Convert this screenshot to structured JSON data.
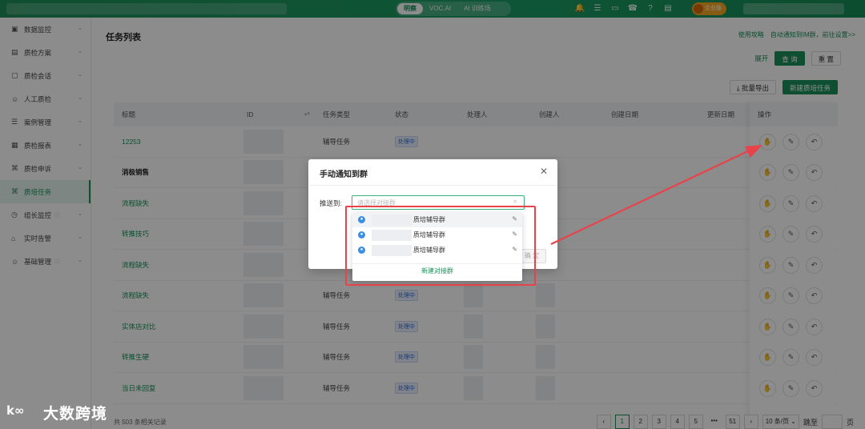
{
  "topbar": {
    "modes": [
      {
        "label": "明察",
        "active": true
      },
      {
        "label": "VOC.AI",
        "active": false
      },
      {
        "label": "AI 训练场",
        "active": false
      }
    ],
    "icons": [
      "bell-icon",
      "sliders-icon",
      "link-icon",
      "headset-icon",
      "help-icon",
      "doc-icon"
    ],
    "enterprise_label": "企业版"
  },
  "sidebar": {
    "items": [
      {
        "label": "数据监控",
        "icon": "monitor-icon",
        "chevron": true,
        "active": false,
        "info": false
      },
      {
        "label": "质检方案",
        "icon": "plan-icon",
        "chevron": true,
        "active": false,
        "info": false
      },
      {
        "label": "质检会话",
        "icon": "chat-icon",
        "chevron": true,
        "active": false,
        "info": false
      },
      {
        "label": "人工质检",
        "icon": "person-icon",
        "chevron": true,
        "active": false,
        "info": false
      },
      {
        "label": "案例管理",
        "icon": "layers-icon",
        "chevron": true,
        "active": false,
        "info": false
      },
      {
        "label": "质检报表",
        "icon": "report-icon",
        "chevron": true,
        "active": false,
        "info": false
      },
      {
        "label": "质检申诉",
        "icon": "appeal-icon",
        "chevron": true,
        "active": false,
        "info": false
      },
      {
        "label": "质培任务",
        "icon": "task-icon",
        "chevron": false,
        "active": true,
        "info": false
      },
      {
        "label": "组长监控",
        "icon": "clock-icon",
        "chevron": true,
        "active": false,
        "info": true
      },
      {
        "label": "实时告警",
        "icon": "alarm-icon",
        "chevron": true,
        "active": false,
        "info": false
      },
      {
        "label": "基础管理",
        "icon": "user-admin-icon",
        "chevron": true,
        "active": false,
        "info": true
      }
    ]
  },
  "main": {
    "title": "任务列表",
    "help_links": [
      "使用攻略",
      "自动通知到IM群，前往设置>>"
    ],
    "expand_label": "展开",
    "query_label": "查 询",
    "reset_label": "重 置",
    "export_label": "批量导出",
    "new_task_label": "新建质培任务"
  },
  "table": {
    "columns": [
      {
        "label": "标题",
        "w": 156
      },
      {
        "label": "ID",
        "w": 95,
        "sort": true
      },
      {
        "label": "任务类型",
        "w": 90
      },
      {
        "label": "状态",
        "w": 90
      },
      {
        "label": "处理人",
        "w": 90
      },
      {
        "label": "创建人",
        "w": 90
      },
      {
        "label": "创建日期",
        "w": 120
      },
      {
        "label": "更新日期",
        "w": 72
      }
    ],
    "ops_header": "操作",
    "rows": [
      {
        "title": "12253",
        "bold": false,
        "type": "辅导任务",
        "status": "处理中"
      },
      {
        "title": "消极销售",
        "bold": true,
        "type": "",
        "status": ""
      },
      {
        "title": "流程缺失",
        "bold": false,
        "type": "",
        "status": ""
      },
      {
        "title": "转推技巧",
        "bold": false,
        "type": "",
        "status": ""
      },
      {
        "title": "流程缺失",
        "bold": false,
        "type": "",
        "status": ""
      },
      {
        "title": "流程缺失",
        "bold": false,
        "type": "辅导任务",
        "status": "处理中"
      },
      {
        "title": "实体店对比",
        "bold": false,
        "type": "辅导任务",
        "status": "处理中"
      },
      {
        "title": "转推生硬",
        "bold": false,
        "type": "辅导任务",
        "status": "处理中"
      },
      {
        "title": "当日未回复",
        "bold": false,
        "type": "辅导任务",
        "status": "处理中"
      }
    ]
  },
  "pagination": {
    "total_text": "共 503 条相关记录",
    "pages": [
      "1",
      "2",
      "3",
      "4",
      "5",
      "•••",
      "51"
    ],
    "active_page": "1",
    "page_size": "10 条/页",
    "jump_label": "跳至",
    "page_unit": "页"
  },
  "modal": {
    "title": "手动通知到群",
    "push_label": "推送到:",
    "placeholder": "请选择对接群",
    "confirm_label": "确 定",
    "options": [
      {
        "label": "质培辅导群"
      },
      {
        "label": "质培辅导群"
      },
      {
        "label": "质培辅导群"
      }
    ],
    "new_group_label": "新建对接群"
  },
  "watermark": {
    "logo": "k∞",
    "text": "大数跨境"
  },
  "colors": {
    "brand": "#1b8f5a",
    "highlight": "#e8434a"
  }
}
